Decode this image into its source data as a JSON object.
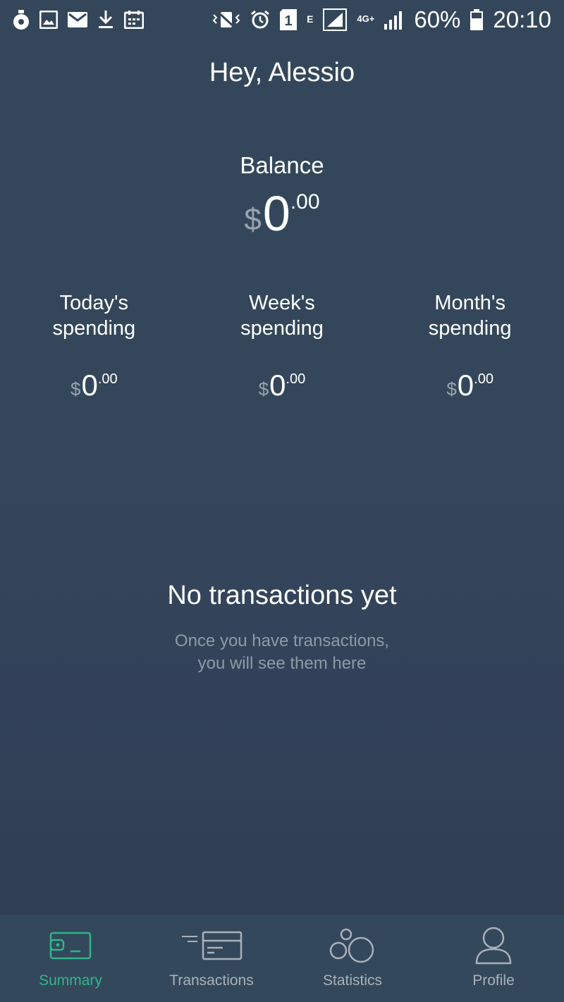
{
  "status_bar": {
    "network_type_small": "E",
    "network_4g": "4G+",
    "battery": "60%",
    "time": "20:10",
    "sim_number": "1",
    "icons": [
      "wallet-notification-icon",
      "image-icon",
      "mail-icon",
      "download-icon",
      "calendar-icon",
      "vibrate-icon",
      "alarm-icon",
      "sim-icon",
      "signal-icon",
      "battery-icon"
    ]
  },
  "greeting": "Hey, Alessio",
  "balance": {
    "label": "Balance",
    "currency": "$",
    "whole": "0",
    "cents": ".00"
  },
  "spending": [
    {
      "label": "Today's\nspending",
      "currency": "$",
      "whole": "0",
      "cents": ".00"
    },
    {
      "label": "Week's\nspending",
      "currency": "$",
      "whole": "0",
      "cents": ".00"
    },
    {
      "label": "Month's\nspending",
      "currency": "$",
      "whole": "0",
      "cents": ".00"
    }
  ],
  "empty_state": {
    "title": "No transactions yet",
    "line1": "Once you have transactions,",
    "line2": "you will see them here"
  },
  "nav": {
    "items": [
      {
        "label": "Summary",
        "icon": "wallet-icon",
        "active": true
      },
      {
        "label": "Transactions",
        "icon": "card-icon",
        "active": false
      },
      {
        "label": "Statistics",
        "icon": "bubbles-icon",
        "active": false
      },
      {
        "label": "Profile",
        "icon": "user-icon",
        "active": false
      }
    ]
  },
  "colors": {
    "accent": "#2fb58a",
    "background": "#34475a",
    "nav_background": "#34485b",
    "muted_text": "#8f9aa5"
  }
}
